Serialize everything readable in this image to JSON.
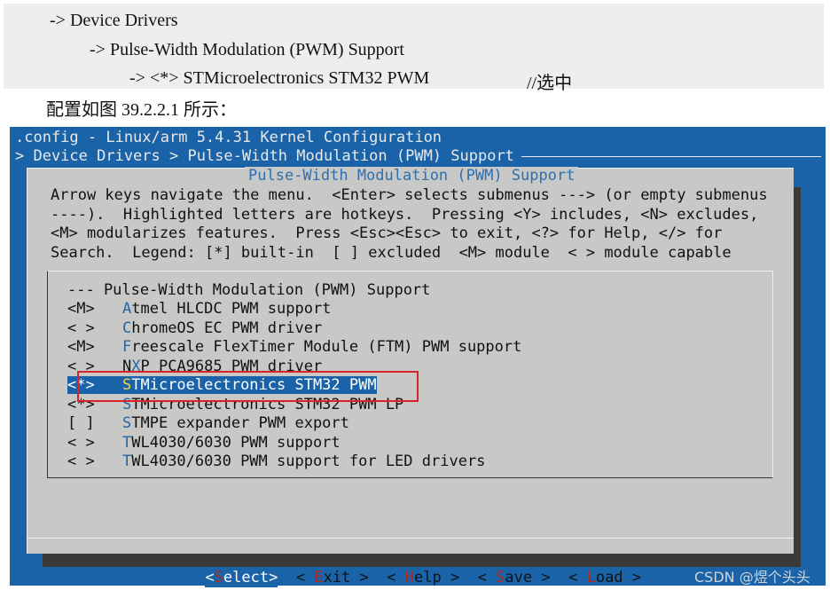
{
  "document": {
    "path_lines": [
      "-> Device Drivers",
      "-> Pulse-Width Modulation (PWM) Support",
      "-> <*> STMicroelectronics STM32 PWM"
    ],
    "path_note": "//选中",
    "caption": "配置如图 39.2.2.1 所示："
  },
  "terminal": {
    "title": ".config - Linux/arm 5.4.31 Kernel Configuration",
    "breadcrumb": "> Device Drivers > Pulse-Width Modulation (PWM) Support",
    "dialog_title": "Pulse-Width Modulation (PWM) Support",
    "help_text": "Arrow keys navigate the menu.  <Enter> selects submenus ---> (or empty submenus\n----).  Highlighted letters are hotkeys.  Pressing <Y> includes, <N> excludes,\n<M> modularizes features.  Press <Esc><Esc> to exit, <?> for Help, </> for\nSearch.  Legend: [*] built-in  [ ] excluded  <M> module  < > module capable",
    "menu_header": "--- Pulse-Width Modulation (PWM) Support",
    "items": [
      {
        "mark": "<M>",
        "hot": "A",
        "rest": "tmel HLCDC PWM support"
      },
      {
        "mark": "< >",
        "hot": "C",
        "rest": "hromeOS EC PWM driver"
      },
      {
        "mark": "<M>",
        "hot": "F",
        "rest": "reescale FlexTimer Module (FTM) PWM support"
      },
      {
        "mark": "< >",
        "pre": "N",
        "hot": "X",
        "rest": "P PCA9685 PWM driver"
      },
      {
        "mark": "<*>",
        "hot": "S",
        "rest": "TMicroelectronics STM32 PWM"
      },
      {
        "mark": "<*>",
        "hot": "S",
        "rest": "TMicroelectronics STM32 PWM LP"
      },
      {
        "mark": "[ ]",
        "hot": "S",
        "rest": "TMPE expander PWM export"
      },
      {
        "mark": "< >",
        "hot": "T",
        "rest": "WL4030/6030 PWM support"
      },
      {
        "mark": "< >",
        "hot": "T",
        "rest": "WL4030/6030 PWM support for LED drivers"
      }
    ],
    "buttons": {
      "select": {
        "open": "<",
        "hot": "S",
        "rest": "elect",
        "close": ">"
      },
      "exit": {
        "open": "< ",
        "hot": "E",
        "rest": "xit",
        "close": " >"
      },
      "help": {
        "open": "< ",
        "hot": "H",
        "rest": "elp",
        "close": " >"
      },
      "save": {
        "open": "< ",
        "hot": "S",
        "rest": "ave",
        "close": " >"
      },
      "load": {
        "open": "< ",
        "hot": "L",
        "rest": "oad",
        "close": " >"
      }
    }
  },
  "watermark": "CSDN @煜个头头",
  "colors": {
    "terminal_bg": "#1b63a8",
    "dialog_bg": "#c8c9c6",
    "highlight_box": "#d8232a",
    "hotkey": "#2b64a3"
  }
}
